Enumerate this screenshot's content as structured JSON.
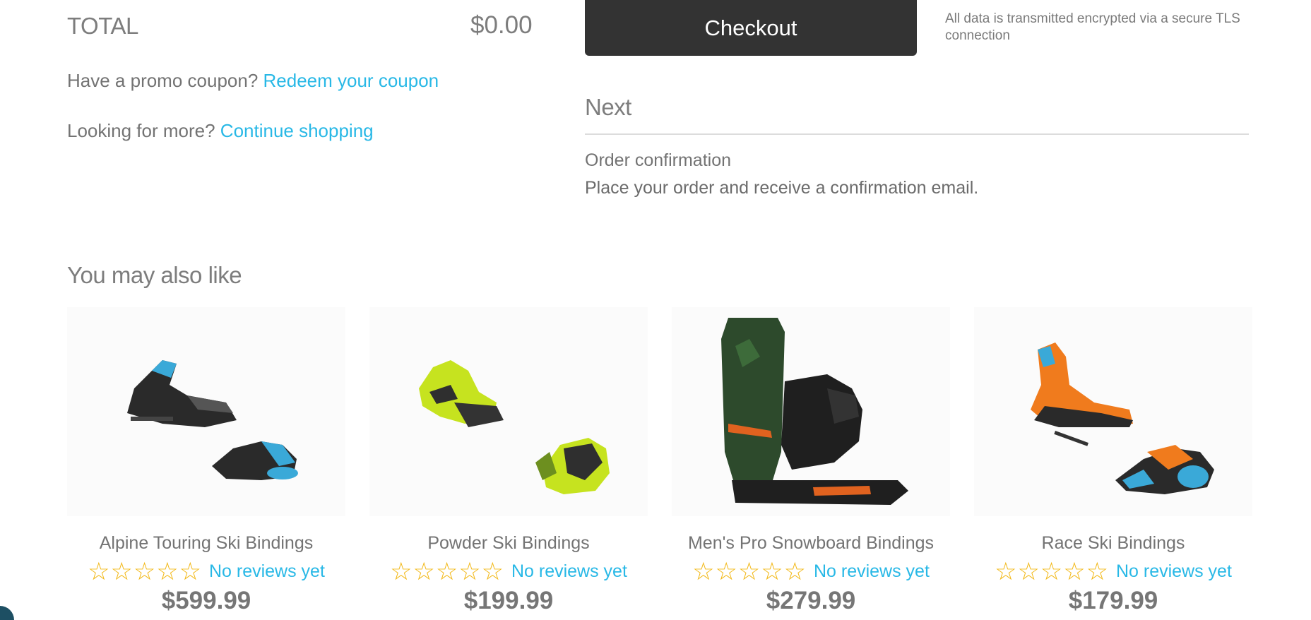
{
  "summary": {
    "total_label": "TOTAL",
    "total_value": "$0.00",
    "promo_prefix": "Have a promo coupon? ",
    "promo_link": "Redeem your coupon",
    "more_prefix": "Looking for more? ",
    "more_link": "Continue shopping"
  },
  "checkout": {
    "button_label": "Checkout",
    "secure_note": "All data is transmitted encrypted via a secure TLS connection"
  },
  "next": {
    "heading": "Next",
    "step_title": "Order confirmation",
    "step_description": "Place your order and receive a confirmation email."
  },
  "related": {
    "heading": "You may also like",
    "products": [
      {
        "name": "Alpine Touring Ski Bindings",
        "rating_stars": 0,
        "reviews_text": "No reviews yet",
        "price": "$599.99"
      },
      {
        "name": "Powder Ski Bindings",
        "rating_stars": 0,
        "reviews_text": "No reviews yet",
        "price": "$199.99"
      },
      {
        "name": "Men's Pro Snowboard Bindings",
        "rating_stars": 0,
        "reviews_text": "No reviews yet",
        "price": "$279.99"
      },
      {
        "name": "Race Ski Bindings",
        "rating_stars": 0,
        "reviews_text": "No reviews yet",
        "price": "$179.99"
      }
    ]
  },
  "colors": {
    "link": "#28b8e6",
    "star": "#f2b816",
    "checkout_button": "#333333"
  },
  "icons": {
    "star": "star-outline-icon"
  }
}
